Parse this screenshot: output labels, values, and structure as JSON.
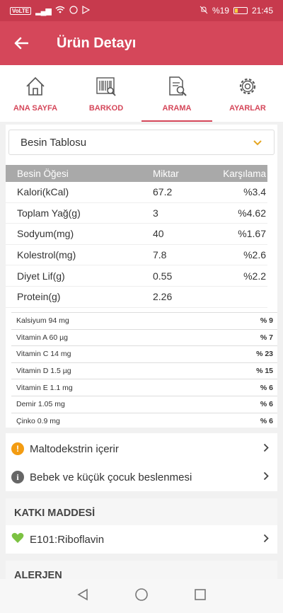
{
  "status_bar": {
    "volte": "VoLTE",
    "signal": "4G",
    "battery_pct": "%19",
    "time": "21:45"
  },
  "app_bar": {
    "title": "Ürün Detayı"
  },
  "tabs": [
    {
      "label": "ANA SAYFA",
      "icon": "home-icon",
      "active": false
    },
    {
      "label": "BARKOD",
      "icon": "barcode-scan-icon",
      "active": false
    },
    {
      "label": "ARAMA",
      "icon": "document-search-icon",
      "active": true
    },
    {
      "label": "AYARLAR",
      "icon": "gear-icon",
      "active": false
    }
  ],
  "dropdown": {
    "value": "Besin Tablosu"
  },
  "nutrient_table": {
    "headers": [
      "Besin Öğesi",
      "Miktar",
      "Karşılama"
    ],
    "rows": [
      {
        "name": "Kalori(kCal)",
        "amount": "67.2",
        "pct": "%3.4"
      },
      {
        "name": "Toplam Yağ(g)",
        "amount": "3",
        "pct": "%4.62"
      },
      {
        "name": "Sodyum(mg)",
        "amount": "40",
        "pct": "%1.67"
      },
      {
        "name": "Kolestrol(mg)",
        "amount": "7.8",
        "pct": "%2.6"
      },
      {
        "name": "Diyet Lif(g)",
        "amount": "0.55",
        "pct": "%2.2"
      },
      {
        "name": "Protein(g)",
        "amount": "2.26",
        "pct": ""
      }
    ]
  },
  "minerals": [
    {
      "name": "Kalsiyum  94  mg",
      "pct": "% 9"
    },
    {
      "name": "Vitamin A  60 µg",
      "pct": "% 7"
    },
    {
      "name": "Vitamin C  14  mg",
      "pct": "% 23"
    },
    {
      "name": "Vitamin D  1.5  µg",
      "pct": "% 15"
    },
    {
      "name": "Vitamin E  1.1  mg",
      "pct": "% 6"
    },
    {
      "name": "Demir  1.05  mg",
      "pct": "% 6"
    },
    {
      "name": "Çinko  0.9  mg",
      "pct": "% 6"
    }
  ],
  "warnings": [
    {
      "text": "Maltodekstrin içerir",
      "icon": "warning-icon",
      "color": "#f39c12"
    },
    {
      "text": "Bebek ve küçük çocuk beslenmesi",
      "icon": "info-icon",
      "color": "#666666"
    }
  ],
  "additives": {
    "header": "KATKI MADDESİ",
    "items": [
      {
        "text": "E101:Riboflavin",
        "icon": "heart-icon",
        "color": "#7cc242"
      }
    ]
  },
  "allergens": {
    "header": "ALERJEN"
  },
  "colors": {
    "brand": "#d5475a",
    "status_bar": "#c73a4d",
    "table_header": "#a9a9a9"
  }
}
